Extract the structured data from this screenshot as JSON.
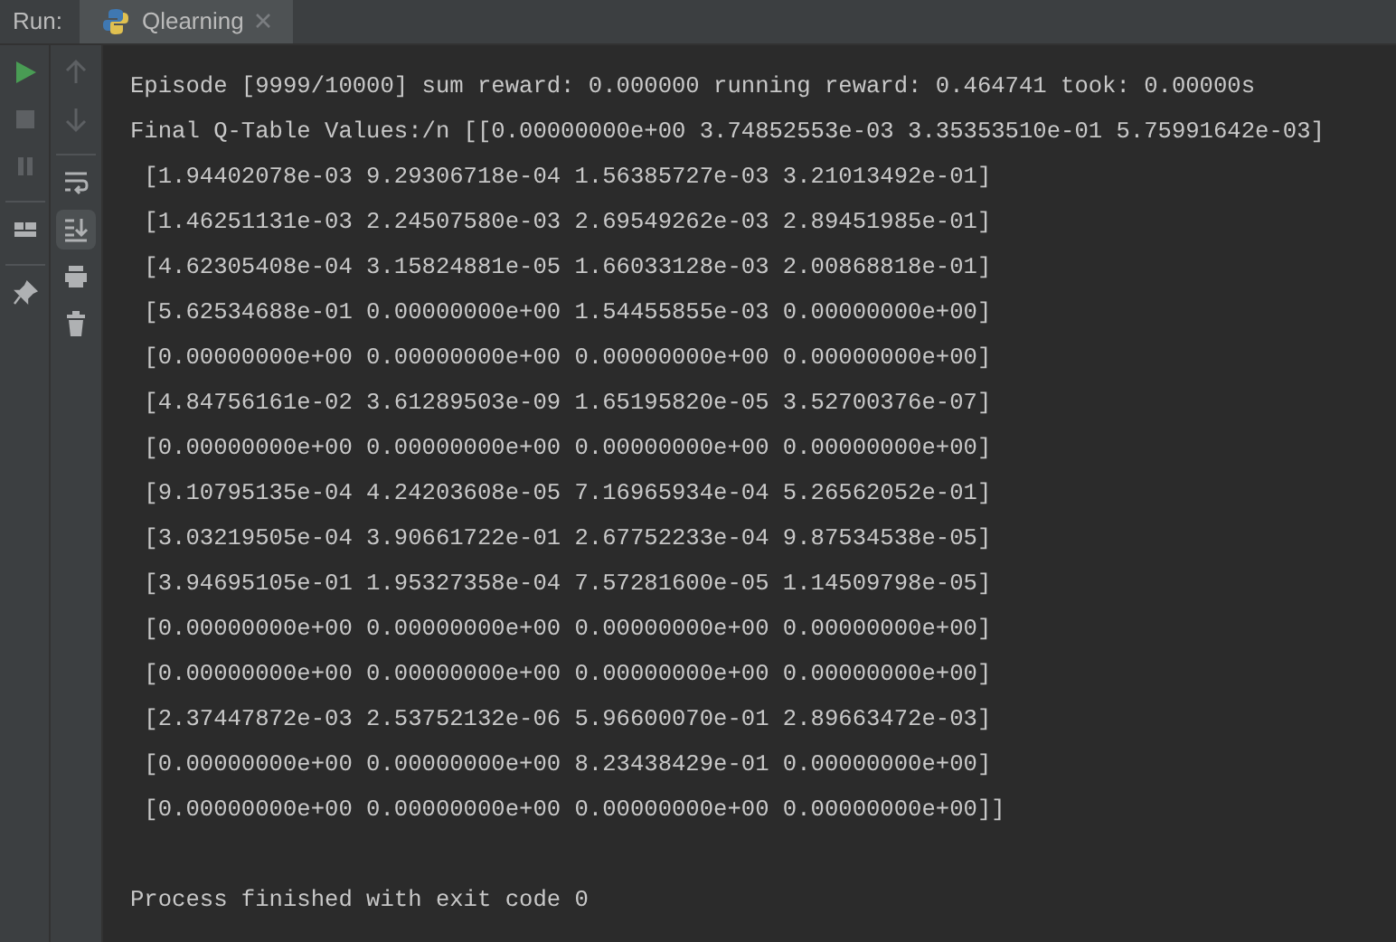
{
  "run_label": "Run:",
  "tab": {
    "title": "Qlearning",
    "selected": true
  },
  "toolbar_left": [
    {
      "kind": "run",
      "enabled": true
    },
    {
      "kind": "stop",
      "enabled": false
    },
    {
      "kind": "pause",
      "enabled": false
    },
    {
      "kind": "layout",
      "enabled": true
    },
    {
      "kind": "pin",
      "enabled": true
    }
  ],
  "toolbar_right": [
    {
      "kind": "up",
      "enabled": false,
      "selected": false
    },
    {
      "kind": "down",
      "enabled": false,
      "selected": false
    },
    {
      "kind": "wrap",
      "enabled": true,
      "selected": false
    },
    {
      "kind": "scroll_end",
      "enabled": true,
      "selected": true
    },
    {
      "kind": "print",
      "enabled": true,
      "selected": false
    },
    {
      "kind": "trash",
      "enabled": true,
      "selected": false
    }
  ],
  "console": {
    "lines": [
      "Episode [9999/10000] sum reward: 0.000000 running reward: 0.464741 took: 0.00000s",
      "Final Q-Table Values:/n [[0.00000000e+00 3.74852553e-03 3.35353510e-01 5.75991642e-03]",
      " [1.94402078e-03 9.29306718e-04 1.56385727e-03 3.21013492e-01]",
      " [1.46251131e-03 2.24507580e-03 2.69549262e-03 2.89451985e-01]",
      " [4.62305408e-04 3.15824881e-05 1.66033128e-03 2.00868818e-01]",
      " [5.62534688e-01 0.00000000e+00 1.54455855e-03 0.00000000e+00]",
      " [0.00000000e+00 0.00000000e+00 0.00000000e+00 0.00000000e+00]",
      " [4.84756161e-02 3.61289503e-09 1.65195820e-05 3.52700376e-07]",
      " [0.00000000e+00 0.00000000e+00 0.00000000e+00 0.00000000e+00]",
      " [9.10795135e-04 4.24203608e-05 7.16965934e-04 5.26562052e-01]",
      " [3.03219505e-04 3.90661722e-01 2.67752233e-04 9.87534538e-05]",
      " [3.94695105e-01 1.95327358e-04 7.57281600e-05 1.14509798e-05]",
      " [0.00000000e+00 0.00000000e+00 0.00000000e+00 0.00000000e+00]",
      " [0.00000000e+00 0.00000000e+00 0.00000000e+00 0.00000000e+00]",
      " [2.37447872e-03 2.53752132e-06 5.96600070e-01 2.89663472e-03]",
      " [0.00000000e+00 0.00000000e+00 8.23438429e-01 0.00000000e+00]",
      " [0.00000000e+00 0.00000000e+00 0.00000000e+00 0.00000000e+00]]"
    ],
    "exit_message": "Process finished with exit code 0"
  }
}
